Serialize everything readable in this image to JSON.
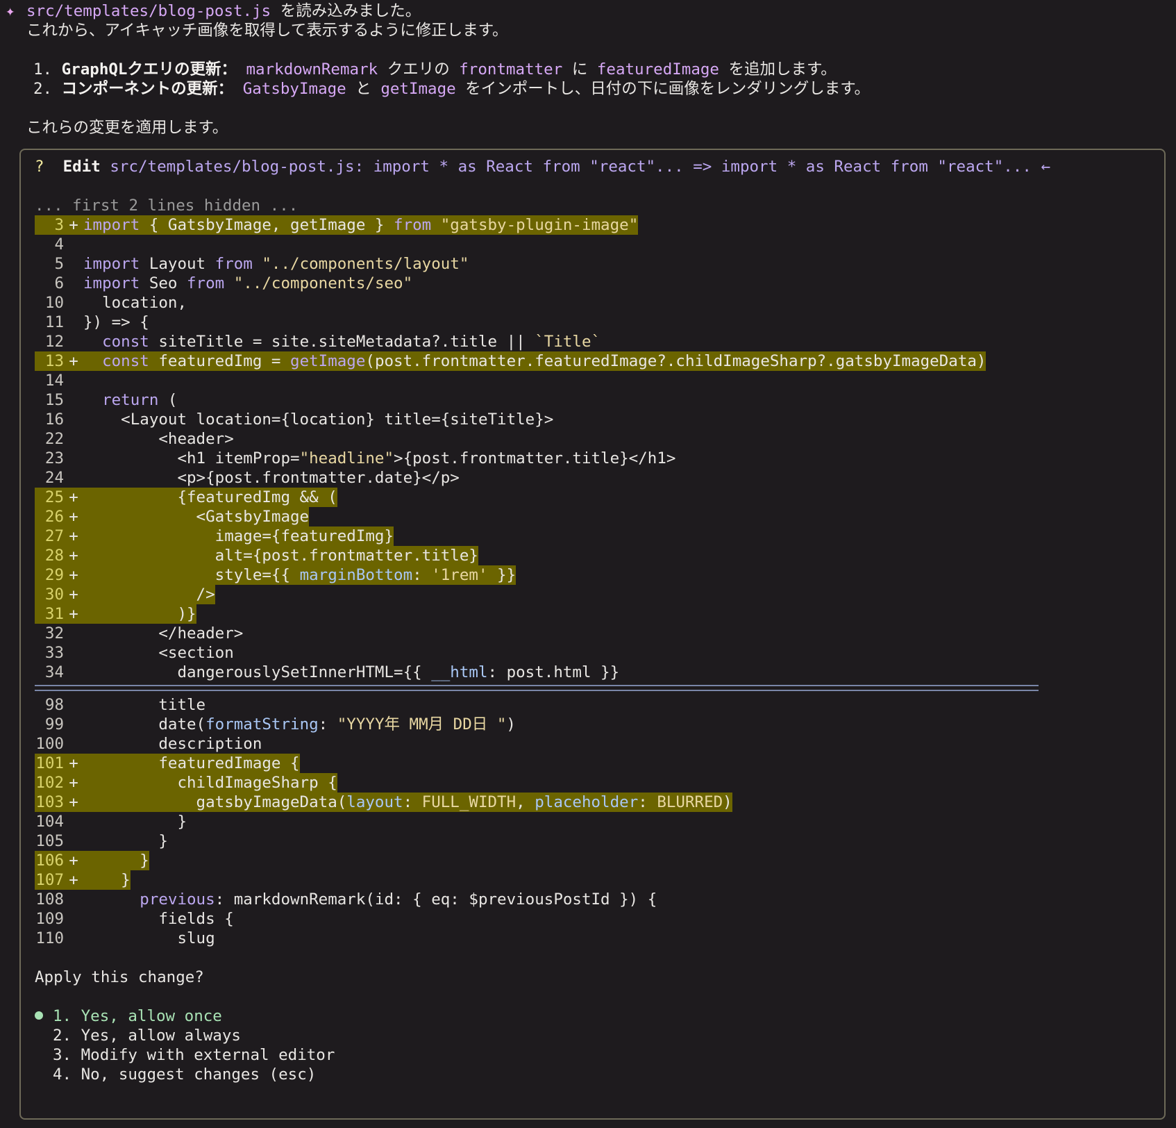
{
  "intro": {
    "icon": "sparkle-icon",
    "file_path": "src/templates/blog-post.js",
    "read_msg": " を読み込みました。",
    "line2": "これから、アイキャッチ画像を取得して表示するように修正します。",
    "steps": [
      {
        "num": "1. ",
        "title": "GraphQLクエリの更新：",
        "t1": " ",
        "c1": "markdownRemark",
        "t2": " クエリの ",
        "c2": "frontmatter",
        "t3": " に ",
        "c3": "featuredImage",
        "t4": " を追加します。"
      },
      {
        "num": "2. ",
        "title": "コンポーネントの更新：",
        "t1": " ",
        "c1": "GatsbyImage",
        "t2": " と ",
        "c2": "getImage",
        "t3": " をインポートし、日付の下に画像をレンダリングします。"
      }
    ],
    "apply_msg": "これらの変更を適用します。"
  },
  "edit": {
    "q": "?",
    "label": "Edit",
    "summary": " src/templates/blog-post.js: import * as React from \"react\"... => import * as React from \"react\"... ←",
    "hidden_note": "... first 2 lines hidden ..."
  },
  "diff_top": [
    {
      "n": "3",
      "added": true
    },
    {
      "n": "4"
    },
    {
      "n": "5"
    },
    {
      "n": "6"
    },
    {
      "n": "10"
    },
    {
      "n": "11"
    },
    {
      "n": "12"
    },
    {
      "n": "13",
      "added": true
    },
    {
      "n": "14"
    },
    {
      "n": "15"
    },
    {
      "n": "16"
    },
    {
      "n": "22"
    },
    {
      "n": "23"
    },
    {
      "n": "24"
    },
    {
      "n": "25",
      "added": true
    },
    {
      "n": "26",
      "added": true
    },
    {
      "n": "27",
      "added": true
    },
    {
      "n": "28",
      "added": true
    },
    {
      "n": "29",
      "added": true
    },
    {
      "n": "30",
      "added": true
    },
    {
      "n": "31",
      "added": true
    },
    {
      "n": "32"
    },
    {
      "n": "33"
    },
    {
      "n": "34"
    }
  ],
  "diff_bottom": [
    {
      "n": "98"
    },
    {
      "n": "99"
    },
    {
      "n": "100"
    },
    {
      "n": "101",
      "added": true
    },
    {
      "n": "102",
      "added": true
    },
    {
      "n": "103",
      "added": true
    },
    {
      "n": "104"
    },
    {
      "n": "105"
    },
    {
      "n": "106",
      "added": true
    },
    {
      "n": "107",
      "added": true
    },
    {
      "n": "108"
    },
    {
      "n": "109"
    },
    {
      "n": "110"
    }
  ],
  "code": {
    "l3": [
      "import",
      " { GatsbyImage, getImage } ",
      "from",
      " \"gatsby-plugin-image\""
    ],
    "l5": [
      "import",
      " Layout ",
      "from",
      " \"../components/layout\""
    ],
    "l6": [
      "import",
      " Seo ",
      "from",
      " \"../components/seo\""
    ],
    "l10": "  location,",
    "l11": "}) => {",
    "l12": [
      "  ",
      "const",
      " siteTitle = site.siteMetadata?.title || ",
      "`Title`"
    ],
    "l13": [
      "  ",
      "const",
      " featuredImg = ",
      "getImage",
      "(post.frontmatter.featuredImage?.childImageSharp?.gatsbyImageData)"
    ],
    "l15": [
      "  ",
      "return",
      " ("
    ],
    "l16": "    <Layout location={location} title={siteTitle}>",
    "l22": "        <header>",
    "l23": [
      "          <h1 itemProp=",
      "\"headline\"",
      ">{post.frontmatter.title}</h1>"
    ],
    "l24": "          <p>{post.frontmatter.date}</p>",
    "l25": "          {featuredImg && (",
    "l26": "            <GatsbyImage",
    "l27": "              image={featuredImg}",
    "l28": "              alt={post.frontmatter.title}",
    "l29": [
      "              style={{ ",
      "marginBottom",
      ": ",
      "'1rem'",
      " }}"
    ],
    "l30": "            />",
    "l31": "          )}",
    "l32": "        </header>",
    "l33": "        <section",
    "l34": [
      "          dangerouslySetInnerHTML={{ ",
      "__html",
      ": post.html }}"
    ],
    "l98": "        title",
    "l99": [
      "        date(",
      "formatString",
      ": ",
      "\"YYYY年 MM月 DD日 \"",
      ")"
    ],
    "l100": "        description",
    "l101": "        featuredImage {",
    "l102": "          childImageSharp {",
    "l103": [
      "            gatsbyImageData(",
      "layout",
      ": ",
      "FULL_WIDTH",
      ", ",
      "placeholder",
      ": ",
      "BLURRED",
      ")"
    ],
    "l104": "          }",
    "l105": "        }",
    "l106": "      }",
    "l107": "    }",
    "l108": [
      "      ",
      "previous",
      ": markdownRemark(id: { eq: $previousPostId }) {"
    ],
    "l109": "        fields {",
    "l110": "          slug"
  },
  "prompt": {
    "question": "Apply this change?",
    "options": [
      "1. Yes, allow once",
      "2. Yes, allow always",
      "3. Modify with external editor",
      "4. No, suggest changes (esc)"
    ],
    "selected_index": 0
  },
  "colors": {
    "background": "#1e1b1e",
    "added_highlight": "#6b6400",
    "keyword": "#bca7f0",
    "accent_green": "#a8e2b4",
    "border": "#6e6a58"
  }
}
